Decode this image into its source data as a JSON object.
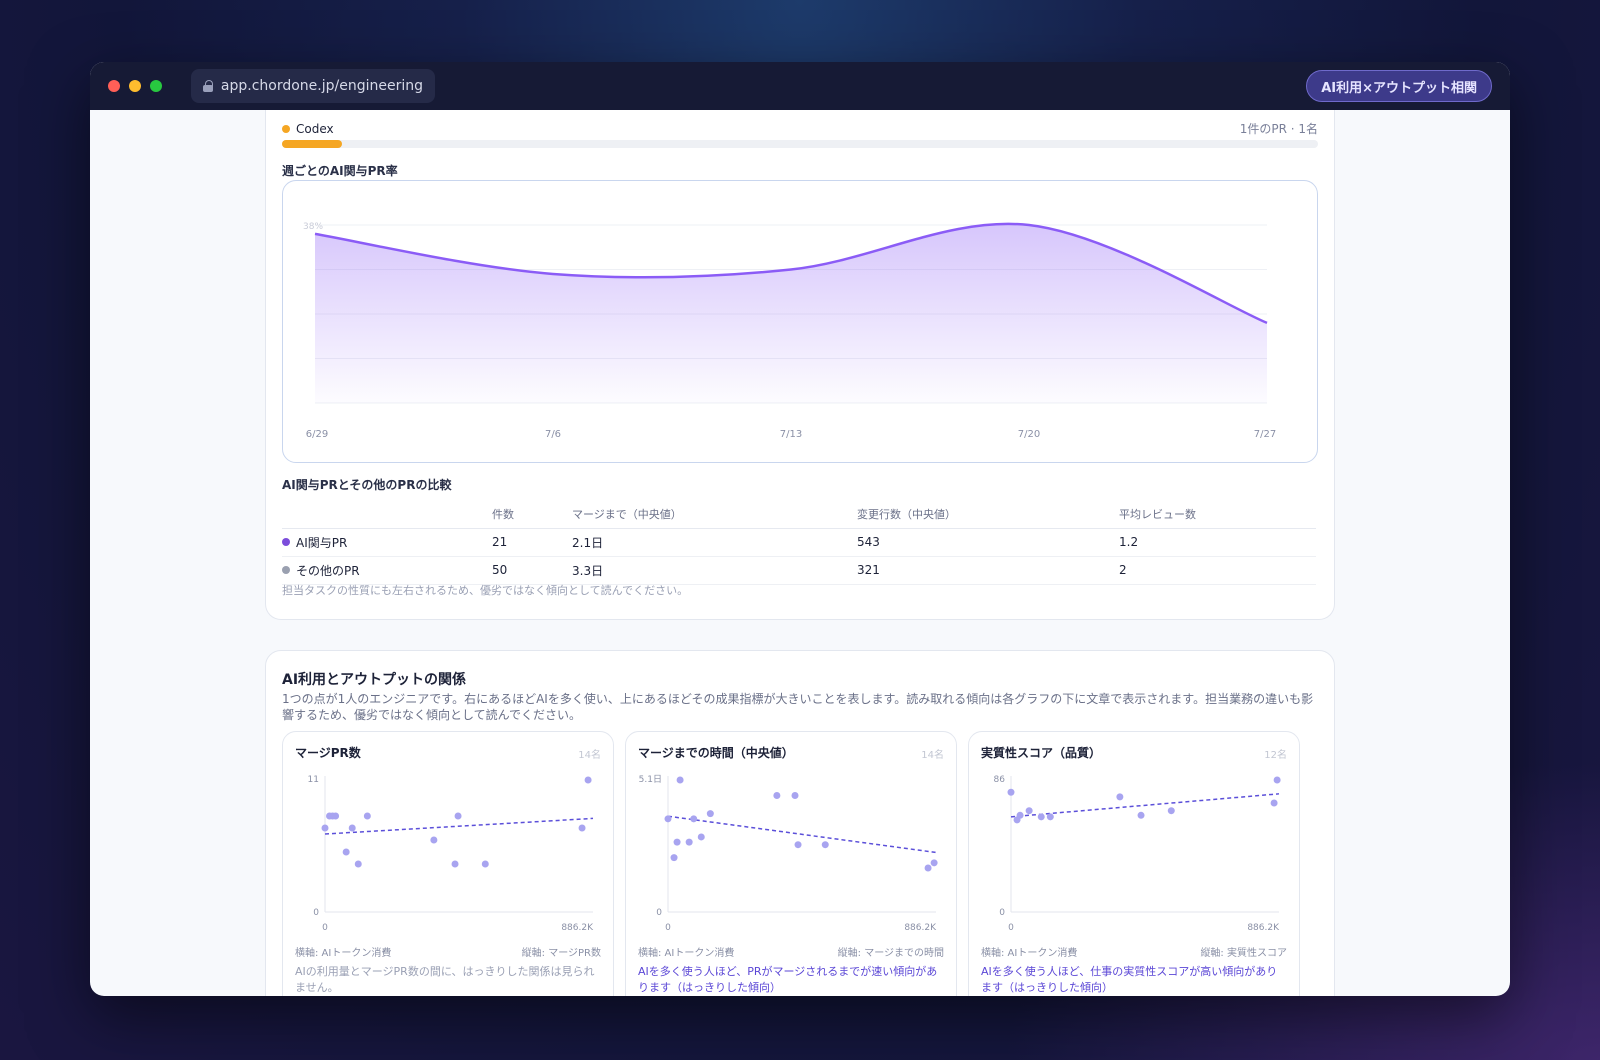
{
  "browser": {
    "url": "app.chordone.jp/engineering",
    "badge": "AI利用×アウトプット相関"
  },
  "codex": {
    "label": "Codex",
    "stats": "1件のPR · 1名",
    "color": "#f5a623",
    "progress": 0.058
  },
  "weekly_chart": {
    "title": "週ごとのAI関与PR率",
    "chart_data": {
      "type": "area",
      "x": [
        "6/29",
        "7/6",
        "7/13",
        "7/20",
        "7/27"
      ],
      "values": [
        38,
        29,
        30,
        40,
        18
      ],
      "ylim": [
        0,
        40
      ],
      "y_tick_label": "38%",
      "color": "#8b5cf6"
    }
  },
  "comparison": {
    "title": "AI関与PRとその他のPRの比較",
    "headers": [
      "",
      "件数",
      "マージまで（中央値）",
      "変更行数（中央値）",
      "平均レビュー数"
    ],
    "rows": [
      {
        "label": "AI関与PR",
        "color": "#7c4ddb",
        "count": "21",
        "merge": "2.1日",
        "lines": "543",
        "reviews": "1.2"
      },
      {
        "label": "その他のPR",
        "color": "#9aa0b0",
        "count": "50",
        "merge": "3.3日",
        "lines": "321",
        "reviews": "2"
      }
    ],
    "note": "担当タスクの性質にも左右されるため、優劣ではなく傾向として読んでください。"
  },
  "relation": {
    "title": "AI利用とアウトプットの関係",
    "desc": "1つの点が1人のエンジニアです。右にあるほどAIを多く使い、上にあるほどその成果指標が大きいことを表します。読み取れる傾向は各グラフの下に文章で表示されます。担当業務の違いも影響するため、優劣ではなく傾向として読んでください。"
  },
  "scatter_charts": [
    {
      "title": "マージPR数",
      "count": "14名",
      "x_label": "横軸: AIトークン消費",
      "y_label": "縦軸: マージPR数",
      "conclusion": "AIの利用量とマージPR数の間に、はっきりした関係は見られません。",
      "conclusion_style": "muted",
      "chart_data": {
        "type": "scatter",
        "xlim": [
          0,
          886.2
        ],
        "ylim": [
          0,
          11
        ],
        "x_ticks": [
          "0",
          "886.2K"
        ],
        "y_ticks": [
          "11",
          "0"
        ],
        "points": [
          [
            0,
            7
          ],
          [
            15,
            8
          ],
          [
            25,
            8
          ],
          [
            35,
            8
          ],
          [
            70,
            5
          ],
          [
            90,
            7
          ],
          [
            110,
            4
          ],
          [
            140,
            8
          ],
          [
            360,
            6
          ],
          [
            430,
            4
          ],
          [
            440,
            8
          ],
          [
            530,
            4
          ],
          [
            850,
            7
          ],
          [
            870,
            11
          ]
        ],
        "trend": [
          [
            0,
            6.5
          ],
          [
            886.2,
            7.8
          ]
        ]
      }
    },
    {
      "title": "マージまでの時間（中央値）",
      "count": "14名",
      "x_label": "横軸: AIトークン消費",
      "y_label": "縦軸: マージまでの時間",
      "conclusion": "AIを多く使う人ほど、PRがマージされるまでが速い傾向があります（はっきりした傾向）",
      "conclusion_style": "accent",
      "chart_data": {
        "type": "scatter",
        "xlim": [
          0,
          886.2
        ],
        "ylim": [
          0,
          5.1
        ],
        "x_ticks": [
          "0",
          "886.2K"
        ],
        "y_ticks": [
          "5.1日",
          "0"
        ],
        "points": [
          [
            0,
            3.6
          ],
          [
            20,
            2.1
          ],
          [
            30,
            2.7
          ],
          [
            40,
            5.1
          ],
          [
            70,
            2.7
          ],
          [
            85,
            3.6
          ],
          [
            110,
            2.9
          ],
          [
            140,
            3.8
          ],
          [
            360,
            4.5
          ],
          [
            420,
            4.5
          ],
          [
            430,
            2.6
          ],
          [
            520,
            2.6
          ],
          [
            860,
            1.7
          ],
          [
            880,
            1.9
          ]
        ],
        "trend": [
          [
            0,
            3.7
          ],
          [
            886.2,
            2.3
          ]
        ]
      }
    },
    {
      "title": "実質性スコア（品質）",
      "count": "12名",
      "x_label": "横軸: AIトークン消費",
      "y_label": "縦軸: 実質性スコア",
      "conclusion": "AIを多く使う人ほど、仕事の実質性スコアが高い傾向があります（はっきりした傾向）",
      "conclusion_style": "accent",
      "chart_data": {
        "type": "scatter",
        "xlim": [
          0,
          886.2
        ],
        "ylim": [
          0,
          86
        ],
        "x_ticks": [
          "0",
          "886.2K"
        ],
        "y_ticks": [
          "86",
          "0"
        ],
        "points": [
          [
            0,
            78
          ],
          [
            20,
            60
          ],
          [
            30,
            63
          ],
          [
            60,
            66
          ],
          [
            100,
            62
          ],
          [
            130,
            62
          ],
          [
            360,
            75
          ],
          [
            430,
            63
          ],
          [
            530,
            66
          ],
          [
            870,
            71
          ],
          [
            880,
            88
          ]
        ],
        "trend": [
          [
            0,
            62
          ],
          [
            886.2,
            77
          ]
        ]
      }
    }
  ]
}
